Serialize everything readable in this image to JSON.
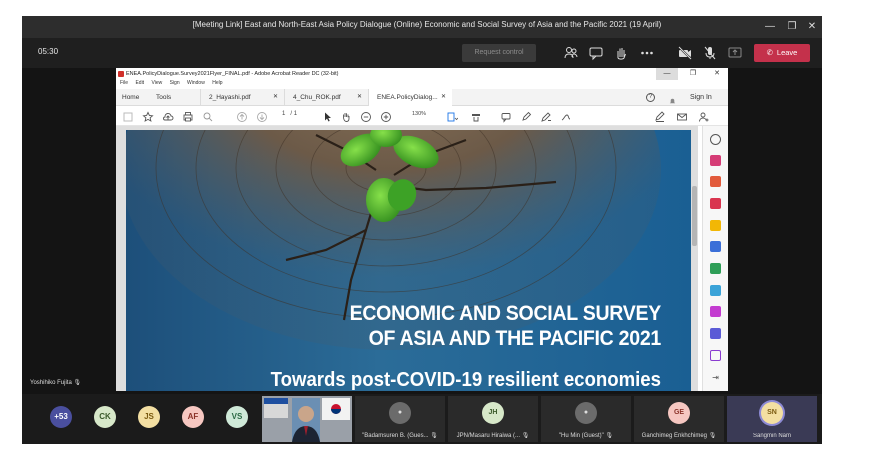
{
  "meeting": {
    "title": "[Meeting Link] East and North-East Asia Policy Dialogue (Online) Economic and Social Survey of Asia and the Pacific 2021 (19 April)",
    "timer": "05:30",
    "request_control": "Request control",
    "leave": "Leave",
    "presenter_name": "Yoshihiko Fujita"
  },
  "acrobat": {
    "window_title": "ENEA.PolicyDialogue.Survey2021Flyer_FINAL.pdf - Adobe Acrobat Reader DC (32-bit)",
    "menu": [
      "File",
      "Edit",
      "View",
      "Sign",
      "Window",
      "Help"
    ],
    "home": "Home",
    "tools": "Tools",
    "tabs": [
      "2_Hayashi.pdf",
      "4_Chu_ROK.pdf",
      "ENEA.PolicyDialog..."
    ],
    "sign_in": "Sign In",
    "page_current": "1",
    "page_total": "/ 1",
    "zoom": "130%"
  },
  "flyer": {
    "heading_line1": "ECONOMIC AND SOCIAL SURVEY",
    "heading_line2": "OF ASIA AND THE PACIFIC 2021",
    "subtitle": "Towards post-COVID-19 resilient economies"
  },
  "participants": {
    "overflow": "+53",
    "avatars": [
      "CK",
      "JS",
      "AF",
      "VS"
    ],
    "tiles": [
      {
        "initials": "",
        "name": "\"Badamsuren B. (Gues..."
      },
      {
        "initials": "JH",
        "name": "JPN/Masaru Hiraiwa (..."
      },
      {
        "initials": "",
        "name": "\"Hu Min (Guest)\""
      },
      {
        "initials": "GE",
        "name": "Ganchimeg Enkhchimeg"
      },
      {
        "initials": "SN",
        "name": "Sangmin Nam"
      }
    ]
  },
  "colors": {
    "leave": "#c4314b",
    "teams_bg": "#1f1f1f",
    "acrobat_pdf_red": "#d0302a"
  }
}
